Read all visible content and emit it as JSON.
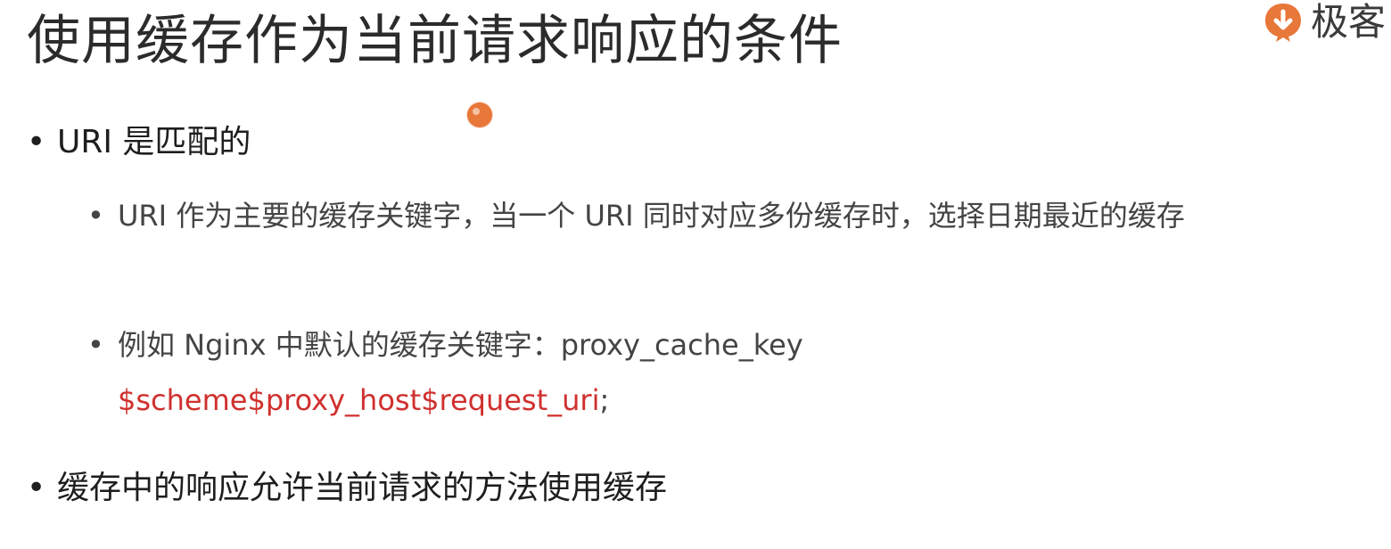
{
  "slide": {
    "title": "使用缓存作为当前请求响应的条件",
    "logo_text": "极客",
    "bullet_glyph": "•",
    "bullets": [
      {
        "text": "URI 是匹配的",
        "sub": [
          {
            "text": "URI 作为主要的缓存关键字，当一个 URI 同时对应多份缓存时，选择日期最近的缓存"
          },
          {
            "text_before": "例如 Nginx 中默认的缓存关键字：proxy_cache_key",
            "code": "$scheme$proxy_host$request_uri",
            "text_after": ";"
          }
        ]
      },
      {
        "text": "缓存中的响应允许当前请求的方法使用缓存"
      }
    ]
  },
  "colors": {
    "code_red": "#d0302e",
    "logo_orange": "#e8773a"
  },
  "icons": {
    "logo": "geekbang-logo-icon",
    "cursor": "cursor-pointer-dot"
  }
}
